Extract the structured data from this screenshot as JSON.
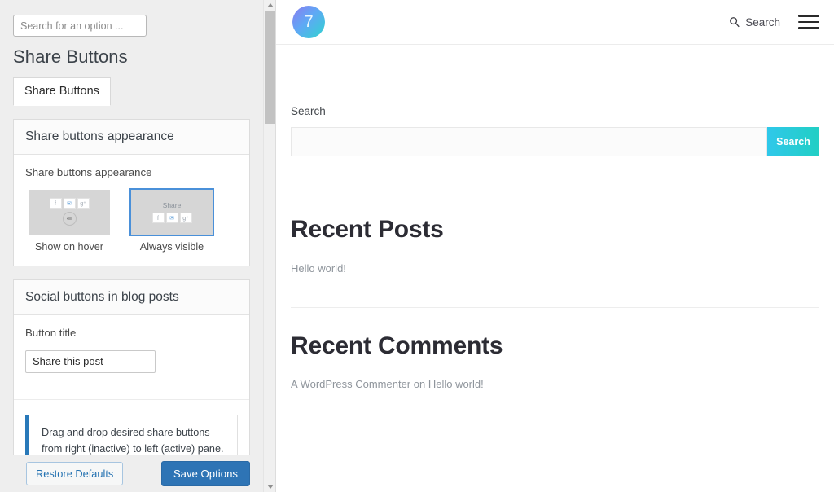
{
  "options_panel": {
    "search": {
      "placeholder": "Search for an option ...",
      "value": ""
    },
    "page_title": "Share Buttons",
    "tabs": [
      {
        "label": "Share Buttons",
        "active": true
      }
    ],
    "cards": [
      {
        "heading": "Share buttons appearance",
        "field_label": "Share buttons appearance",
        "choices": [
          {
            "caption": "Show on hover",
            "selected": false,
            "share_label": "",
            "chips": [
              "f",
              "✉",
              "g⁺"
            ],
            "has_round_toggle": true
          },
          {
            "caption": "Always visible",
            "selected": true,
            "share_label": "Share",
            "chips": [
              "f",
              "✉",
              "g⁺"
            ],
            "has_round_toggle": false
          }
        ]
      },
      {
        "heading": "Social buttons in blog posts",
        "field_label": "Button title",
        "input_value": "Share this post",
        "input_placeholder": "Share this post"
      }
    ],
    "notice": {
      "line1": "Drag and drop desired share buttons",
      "line2": "from right (inactive) to left (active) pane."
    },
    "actions": {
      "restore_label": "Restore Defaults",
      "save_label": "Save Options"
    },
    "scrollbar": {
      "up_icon": "caret-up-icon",
      "down_icon": "caret-down-icon"
    }
  },
  "preview": {
    "header": {
      "avatar_text": "7",
      "search_label": "Search",
      "search_icon": "magnifier-icon",
      "menu_icon": "hamburger-menu-icon"
    },
    "widgets": {
      "search": {
        "label": "Search",
        "input_value": "",
        "input_placeholder": "",
        "button_label": "Search"
      },
      "recent_posts": {
        "title": "Recent Posts",
        "items": [
          "Hello world!"
        ]
      },
      "recent_comments": {
        "title": "Recent Comments",
        "entries": [
          {
            "author": "A WordPress Commenter",
            "connector": " on ",
            "post": "Hello world!"
          }
        ]
      }
    }
  },
  "colors": {
    "accent_blue": "#2e74b5",
    "link_blue": "#2271b1",
    "selected_outline": "#4a90d9",
    "notice_bar": "#2979b9",
    "search_button_from": "#2fc8ea",
    "search_button_to": "#21cfc4",
    "panel_bg": "#eeeeee"
  }
}
